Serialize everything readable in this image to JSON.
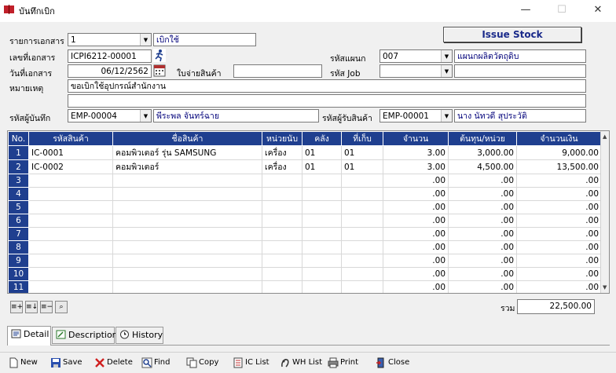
{
  "window": {
    "title": "บันทึกเบิก",
    "minimize": "—",
    "maximize": "☐",
    "close": "✕"
  },
  "form": {
    "doc_type_label": "รายการเอกสาร",
    "doc_type_value": "1",
    "doc_type_desc": "เบิกใช้",
    "doc_no_label": "เลขที่เอกสาร",
    "doc_no_value": "ICPI6212-00001",
    "doc_date_label": "วันที่เอกสาร",
    "doc_date_value": "06/12/2562",
    "receipt_label": "ใบจ่ายสินค้า",
    "receipt_value": "",
    "remark_label": "หมายเหตุ",
    "remark_value": "ขอเบิกใช้อุปกรณ์สำนักงาน",
    "remark2_value": "",
    "dept_label": "รหัสแผนก",
    "dept_value": "007",
    "dept_desc": "แผนกผลิตวัตถุดิบ",
    "job_label": "รหัส Job",
    "job_value": "",
    "job_desc": "",
    "recorder_label": "รหัสผู้บันทึก",
    "recorder_value": "EMP-00004",
    "recorder_name": "พีระพล จันทร์ฉาย",
    "receiver_label": "รหัสผู้รับสินค้า",
    "receiver_value": "EMP-00001",
    "receiver_name": "นาง นัทวดี สุประวัติ",
    "issue_button": "Issue Stock"
  },
  "grid": {
    "headers": [
      "No.",
      "รหัสสินค้า",
      "ชื่อสินค้า",
      "หน่วยนับ",
      "คลัง",
      "ที่เก็บ",
      "จำนวน",
      "ต้นทุน/หน่วย",
      "จำนวนเงิน"
    ],
    "rows": [
      {
        "no": "1",
        "code": "IC-0001",
        "name": "คอมพิวเตอร์ รุ่น SAMSUNG",
        "unit": "เครื่อง",
        "wh": "01",
        "loc": "01",
        "qty": "3.00",
        "cost": "3,000.00",
        "amount": "9,000.00"
      },
      {
        "no": "2",
        "code": "IC-0002",
        "name": "คอมพิวเตอร์",
        "unit": "เครื่อง",
        "wh": "01",
        "loc": "01",
        "qty": "3.00",
        "cost": "4,500.00",
        "amount": "13,500.00"
      },
      {
        "no": "3",
        "code": "",
        "name": "",
        "unit": "",
        "wh": "",
        "loc": "",
        "qty": ".00",
        "cost": ".00",
        "amount": ".00"
      },
      {
        "no": "4",
        "code": "",
        "name": "",
        "unit": "",
        "wh": "",
        "loc": "",
        "qty": ".00",
        "cost": ".00",
        "amount": ".00"
      },
      {
        "no": "5",
        "code": "",
        "name": "",
        "unit": "",
        "wh": "",
        "loc": "",
        "qty": ".00",
        "cost": ".00",
        "amount": ".00"
      },
      {
        "no": "6",
        "code": "",
        "name": "",
        "unit": "",
        "wh": "",
        "loc": "",
        "qty": ".00",
        "cost": ".00",
        "amount": ".00"
      },
      {
        "no": "7",
        "code": "",
        "name": "",
        "unit": "",
        "wh": "",
        "loc": "",
        "qty": ".00",
        "cost": ".00",
        "amount": ".00"
      },
      {
        "no": "8",
        "code": "",
        "name": "",
        "unit": "",
        "wh": "",
        "loc": "",
        "qty": ".00",
        "cost": ".00",
        "amount": ".00"
      },
      {
        "no": "9",
        "code": "",
        "name": "",
        "unit": "",
        "wh": "",
        "loc": "",
        "qty": ".00",
        "cost": ".00",
        "amount": ".00"
      },
      {
        "no": "10",
        "code": "",
        "name": "",
        "unit": "",
        "wh": "",
        "loc": "",
        "qty": ".00",
        "cost": ".00",
        "amount": ".00"
      },
      {
        "no": "11",
        "code": "",
        "name": "",
        "unit": "",
        "wh": "",
        "loc": "",
        "qty": ".00",
        "cost": ".00",
        "amount": ".00"
      }
    ]
  },
  "total": {
    "label": "รวม",
    "value": "22,500.00"
  },
  "tabs": [
    {
      "label": "Detail",
      "icon": "detail-icon",
      "active": true
    },
    {
      "label": "Description",
      "icon": "description-icon",
      "active": false
    },
    {
      "label": "History",
      "icon": "history-icon",
      "active": false
    }
  ],
  "toolbar": [
    {
      "label": "New",
      "icon": "new-document-icon"
    },
    {
      "label": "Save",
      "icon": "save-icon"
    },
    {
      "label": "Delete",
      "icon": "delete-icon"
    },
    {
      "label": "Find",
      "icon": "find-icon"
    },
    {
      "label": "Copy",
      "icon": "copy-icon"
    },
    {
      "label": "IC List",
      "icon": "ic-list-icon"
    },
    {
      "label": "WH List",
      "icon": "wh-list-icon"
    },
    {
      "label": "Print",
      "icon": "print-icon"
    },
    {
      "label": "Close",
      "icon": "close-door-icon"
    }
  ],
  "colors": {
    "grid_header": "#1f3f8f",
    "issue_text": "#1a2a8a",
    "desc_text": "#00007a"
  }
}
